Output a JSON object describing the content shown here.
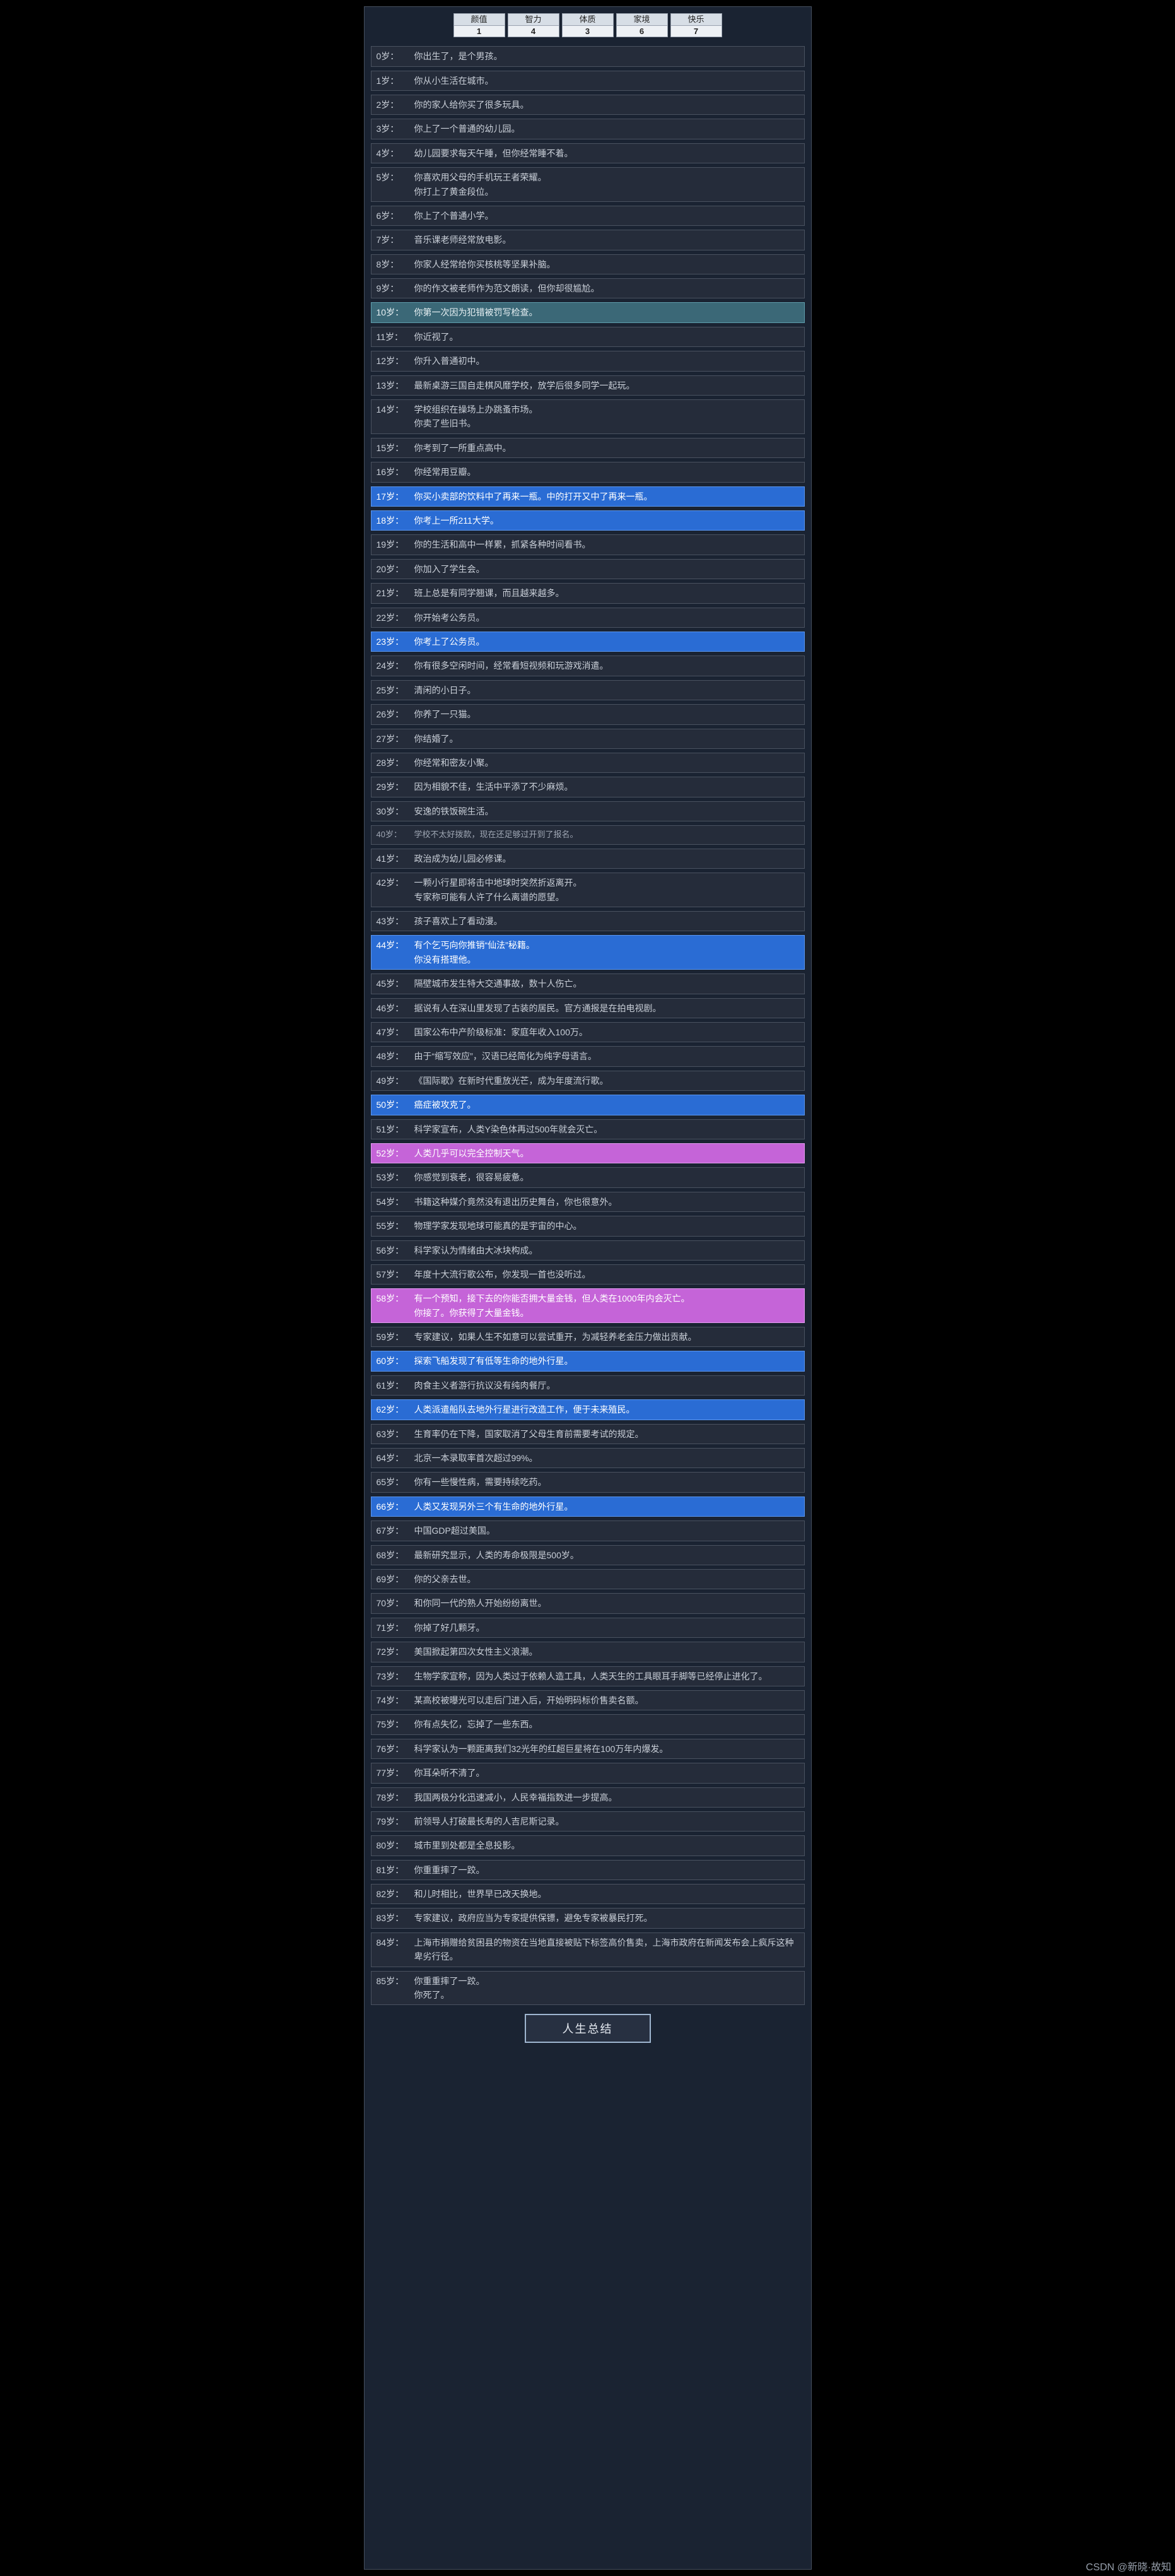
{
  "stats": [
    {
      "label": "颜值",
      "value": "1"
    },
    {
      "label": "智力",
      "value": "4"
    },
    {
      "label": "体质",
      "value": "3"
    },
    {
      "label": "家境",
      "value": "6"
    },
    {
      "label": "快乐",
      "value": "7"
    }
  ],
  "events": [
    {
      "age": "0岁：",
      "text": "你出生了，是个男孩。",
      "cls": ""
    },
    {
      "age": "1岁：",
      "text": "你从小生活在城市。",
      "cls": ""
    },
    {
      "age": "2岁：",
      "text": "你的家人给你买了很多玩具。",
      "cls": ""
    },
    {
      "age": "3岁：",
      "text": "你上了一个普通的幼儿园。",
      "cls": ""
    },
    {
      "age": "4岁：",
      "text": "幼儿园要求每天午睡，但你经常睡不着。",
      "cls": ""
    },
    {
      "age": "5岁：",
      "text": "你喜欢用父母的手机玩王者荣耀。\n你打上了黄金段位。",
      "cls": ""
    },
    {
      "age": "6岁：",
      "text": "你上了个普通小学。",
      "cls": ""
    },
    {
      "age": "7岁：",
      "text": "音乐课老师经常放电影。",
      "cls": ""
    },
    {
      "age": "8岁：",
      "text": "你家人经常给你买核桃等坚果补脑。",
      "cls": ""
    },
    {
      "age": "9岁：",
      "text": "你的作文被老师作为范文朗读，但你却很尴尬。",
      "cls": ""
    },
    {
      "age": "10岁：",
      "text": "你第一次因为犯错被罚写检查。",
      "cls": "hl-cyan"
    },
    {
      "age": "11岁：",
      "text": "你近视了。",
      "cls": ""
    },
    {
      "age": "12岁：",
      "text": "你升入普通初中。",
      "cls": ""
    },
    {
      "age": "13岁：",
      "text": "最新桌游三国自走棋风靡学校，放学后很多同学一起玩。",
      "cls": ""
    },
    {
      "age": "14岁：",
      "text": "学校组织在操场上办跳蚤市场。\n你卖了些旧书。",
      "cls": ""
    },
    {
      "age": "15岁：",
      "text": "你考到了一所重点高中。",
      "cls": ""
    },
    {
      "age": "16岁：",
      "text": "你经常用豆瓣。",
      "cls": ""
    },
    {
      "age": "17岁：",
      "text": "你买小卖部的饮料中了再来一瓶。中的打开又中了再来一瓶。",
      "cls": "hl-blue"
    },
    {
      "age": "18岁：",
      "text": "你考上一所211大学。",
      "cls": "hl-blue"
    },
    {
      "age": "19岁：",
      "text": "你的生活和高中一样累，抓紧各种时间看书。",
      "cls": ""
    },
    {
      "age": "20岁：",
      "text": "你加入了学生会。",
      "cls": ""
    },
    {
      "age": "21岁：",
      "text": "班上总是有同学翘课，而且越来越多。",
      "cls": ""
    },
    {
      "age": "22岁：",
      "text": "你开始考公务员。",
      "cls": ""
    },
    {
      "age": "23岁：",
      "text": "你考上了公务员。",
      "cls": "hl-blue"
    },
    {
      "age": "24岁：",
      "text": "你有很多空闲时间，经常看短视频和玩游戏消遣。",
      "cls": ""
    },
    {
      "age": "25岁：",
      "text": "清闲的小日子。",
      "cls": ""
    },
    {
      "age": "26岁：",
      "text": "你养了一只猫。",
      "cls": ""
    },
    {
      "age": "27岁：",
      "text": "你结婚了。",
      "cls": ""
    },
    {
      "age": "28岁：",
      "text": "你经常和密友小聚。",
      "cls": ""
    },
    {
      "age": "29岁：",
      "text": "因为相貌不佳，生活中平添了不少麻烦。",
      "cls": ""
    },
    {
      "age": "30岁：",
      "text": "安逸的铁饭碗生活。",
      "cls": ""
    },
    {
      "age": "40岁：",
      "text": "学校不太好拨款，现在还足够过开到了报名。",
      "cls": "partial"
    },
    {
      "age": "41岁：",
      "text": "政治成为幼儿园必修课。",
      "cls": ""
    },
    {
      "age": "42岁：",
      "text": "一颗小行星即将击中地球时突然折返离开。\n专家称可能有人许了什么离谱的愿望。",
      "cls": ""
    },
    {
      "age": "43岁：",
      "text": "孩子喜欢上了看动漫。",
      "cls": ""
    },
    {
      "age": "44岁：",
      "text": "有个乞丐向你推销“仙法”秘籍。\n你没有搭理他。",
      "cls": "hl-blue"
    },
    {
      "age": "45岁：",
      "text": "隔壁城市发生特大交通事故，数十人伤亡。",
      "cls": ""
    },
    {
      "age": "46岁：",
      "text": "据说有人在深山里发现了古装的居民。官方通报是在拍电视剧。",
      "cls": ""
    },
    {
      "age": "47岁：",
      "text": "国家公布中产阶级标准：家庭年收入100万。",
      "cls": ""
    },
    {
      "age": "48岁：",
      "text": "由于“缩写效应”，汉语已经简化为纯字母语言。",
      "cls": ""
    },
    {
      "age": "49岁：",
      "text": "《国际歌》在新时代重放光芒，成为年度流行歌。",
      "cls": ""
    },
    {
      "age": "50岁：",
      "text": "癌症被攻克了。",
      "cls": "hl-blue"
    },
    {
      "age": "51岁：",
      "text": "科学家宣布，人类Y染色体再过500年就会灭亡。",
      "cls": ""
    },
    {
      "age": "52岁：",
      "text": "人类几乎可以完全控制天气。",
      "cls": "hl-pink"
    },
    {
      "age": "53岁：",
      "text": "你感觉到衰老，很容易疲惫。",
      "cls": ""
    },
    {
      "age": "54岁：",
      "text": "书籍这种媒介竟然没有退出历史舞台，你也很意外。",
      "cls": ""
    },
    {
      "age": "55岁：",
      "text": "物理学家发现地球可能真的是宇宙的中心。",
      "cls": ""
    },
    {
      "age": "56岁：",
      "text": "科学家认为情绪由大冰块构成。",
      "cls": ""
    },
    {
      "age": "57岁：",
      "text": "年度十大流行歌公布，你发现一首也没听过。",
      "cls": ""
    },
    {
      "age": "58岁：",
      "text": "有一个预知，接下去的你能否拥大量金钱，但人类在1000年内会灭亡。\n你接了。你获得了大量金钱。",
      "cls": "hl-pink"
    },
    {
      "age": "59岁：",
      "text": "专家建议，如果人生不如意可以尝试重开，为减轻养老金压力做出贡献。",
      "cls": ""
    },
    {
      "age": "60岁：",
      "text": "探索飞船发现了有低等生命的地外行星。",
      "cls": "hl-blue"
    },
    {
      "age": "61岁：",
      "text": "肉食主义者游行抗议没有纯肉餐厅。",
      "cls": ""
    },
    {
      "age": "62岁：",
      "text": "人类派遣船队去地外行星进行改造工作，便于未来殖民。",
      "cls": "hl-blue"
    },
    {
      "age": "63岁：",
      "text": "生育率仍在下降，国家取消了父母生育前需要考试的规定。",
      "cls": ""
    },
    {
      "age": "64岁：",
      "text": "北京一本录取率首次超过99%。",
      "cls": ""
    },
    {
      "age": "65岁：",
      "text": "你有一些慢性病，需要持续吃药。",
      "cls": ""
    },
    {
      "age": "66岁：",
      "text": "人类又发现另外三个有生命的地外行星。",
      "cls": "hl-blue"
    },
    {
      "age": "67岁：",
      "text": "中国GDP超过美国。",
      "cls": ""
    },
    {
      "age": "68岁：",
      "text": "最新研究显示，人类的寿命极限是500岁。",
      "cls": ""
    },
    {
      "age": "69岁：",
      "text": "你的父亲去世。",
      "cls": ""
    },
    {
      "age": "70岁：",
      "text": "和你同一代的熟人开始纷纷离世。",
      "cls": ""
    },
    {
      "age": "71岁：",
      "text": "你掉了好几颗牙。",
      "cls": ""
    },
    {
      "age": "72岁：",
      "text": "美国掀起第四次女性主义浪潮。",
      "cls": ""
    },
    {
      "age": "73岁：",
      "text": "生物学家宣称，因为人类过于依赖人造工具，人类天生的工具眼耳手脚等已经停止进化了。",
      "cls": ""
    },
    {
      "age": "74岁：",
      "text": "某高校被曝光可以走后门进入后，开始明码标价售卖名额。",
      "cls": ""
    },
    {
      "age": "75岁：",
      "text": "你有点失忆，忘掉了一些东西。",
      "cls": ""
    },
    {
      "age": "76岁：",
      "text": "科学家认为一颗距离我们32光年的红超巨星将在100万年内爆发。",
      "cls": ""
    },
    {
      "age": "77岁：",
      "text": "你耳朵听不清了。",
      "cls": ""
    },
    {
      "age": "78岁：",
      "text": "我国两极分化迅速减小，人民幸福指数进一步提高。",
      "cls": ""
    },
    {
      "age": "79岁：",
      "text": "前领导人打破最长寿的人吉尼斯记录。",
      "cls": ""
    },
    {
      "age": "80岁：",
      "text": "城市里到处都是全息投影。",
      "cls": ""
    },
    {
      "age": "81岁：",
      "text": "你重重摔了一跤。",
      "cls": ""
    },
    {
      "age": "82岁：",
      "text": "和儿时相比，世界早已改天换地。",
      "cls": ""
    },
    {
      "age": "83岁：",
      "text": "专家建议，政府应当为专家提供保镖，避免专家被暴民打死。",
      "cls": ""
    },
    {
      "age": "84岁：",
      "text": "上海市捐赠给贫困县的物资在当地直接被贴下标签高价售卖，上海市政府在新闻发布会上疯斥这种卑劣行径。",
      "cls": ""
    },
    {
      "age": "85岁：",
      "text": "你重重摔了一跤。\n你死了。",
      "cls": ""
    }
  ],
  "summary_button": "人生总结",
  "watermark": "CSDN @新晓·故知"
}
